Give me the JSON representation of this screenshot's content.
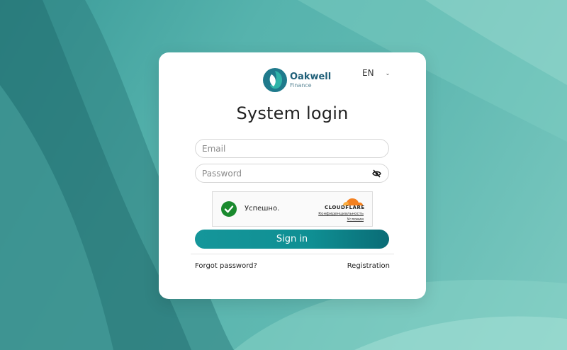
{
  "brand": {
    "name": "Oakwell",
    "subtitle": "Finance",
    "primary_color": "#1f5f78",
    "accent_color": "#15969a"
  },
  "language": {
    "selected": "EN"
  },
  "form": {
    "title": "System login",
    "email": {
      "placeholder": "Email",
      "value": ""
    },
    "password": {
      "placeholder": "Password",
      "value": ""
    },
    "captcha": {
      "status": "Успешно.",
      "provider": "CLOUDFLARE",
      "privacy_label": "Конфиденциальность",
      "terms_label": "Условия"
    },
    "submit_label": "Sign in",
    "forgot_label": "Forgot password?",
    "register_label": "Registration"
  }
}
